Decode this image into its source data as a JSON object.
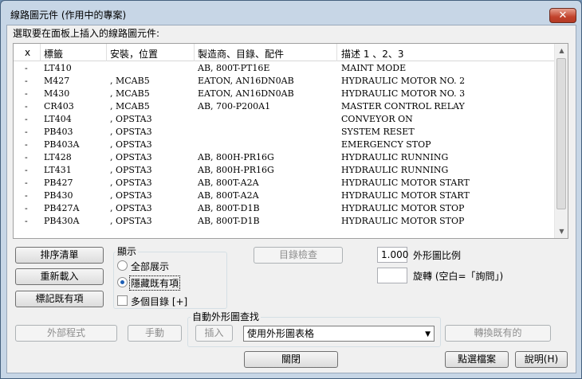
{
  "window": {
    "title": "線路圖元件 (作用中的專案)",
    "close_label": "✕"
  },
  "prompt": "選取要在面板上插入的線路圖元件:",
  "table": {
    "columns": [
      "x",
      "標籤",
      "安裝，位置",
      "製造商、目錄、配件",
      "描述 1 、2、3"
    ],
    "rows": [
      [
        "-",
        "LT410",
        "",
        "AB, 800T-PT16E",
        "MAINT MODE"
      ],
      [
        "-",
        "M427",
        ", MCAB5",
        "EATON, AN16DN0AB",
        "HYDRAULIC MOTOR NO. 2"
      ],
      [
        "-",
        "M430",
        ", MCAB5",
        "EATON, AN16DN0AB",
        "HYDRAULIC MOTOR NO. 3"
      ],
      [
        "-",
        "CR403",
        ", MCAB5",
        "AB, 700-P200A1",
        "MASTER CONTROL RELAY"
      ],
      [
        "-",
        "LT404",
        ", OPSTA3",
        "",
        "CONVEYOR ON"
      ],
      [
        "-",
        "PB403",
        ", OPSTA3",
        "",
        "SYSTEM RESET"
      ],
      [
        "-",
        "PB403A",
        ", OPSTA3",
        "",
        "EMERGENCY STOP"
      ],
      [
        "-",
        "LT428",
        ", OPSTA3",
        "AB, 800H-PR16G",
        "HYDRAULIC RUNNING"
      ],
      [
        "-",
        "LT431",
        ", OPSTA3",
        "AB, 800H-PR16G",
        "HYDRAULIC RUNNING"
      ],
      [
        "-",
        "PB427",
        ", OPSTA3",
        "AB, 800T-A2A",
        "HYDRAULIC MOTOR START"
      ],
      [
        "-",
        "PB430",
        ", OPSTA3",
        "AB, 800T-A2A",
        "HYDRAULIC MOTOR START"
      ],
      [
        "-",
        "PB427A",
        ", OPSTA3",
        "AB, 800T-D1B",
        "HYDRAULIC MOTOR STOP"
      ],
      [
        "-",
        "PB430A",
        ", OPSTA3",
        "AB, 800T-D1B",
        "HYDRAULIC MOTOR STOP"
      ]
    ]
  },
  "left_buttons": {
    "sort": "排序清單",
    "reload": "重新載入",
    "mark": "標記既有項"
  },
  "display": {
    "group_label": "顯示",
    "show_all": "全部展示",
    "hide_existing": "隱藏既有項",
    "multi_catalog": "多個目錄 [+]",
    "selected": "hide_existing",
    "multi_checked": false
  },
  "catalog_check": "目錄檢查",
  "scale": {
    "value": "1.000",
    "label": "外形圖比例"
  },
  "rotate": {
    "value": "",
    "label": "旋轉 (空白=「詢問」)"
  },
  "auto_lookup": {
    "group_label": "自動外形圖查找",
    "insert": "插入",
    "combo_value": "使用外形圖表格"
  },
  "bottom_buttons": {
    "external": "外部程式",
    "manual": "手動",
    "convert": "轉換既有的",
    "close": "關閉",
    "pick_file": "點選檔案",
    "help": "說明(H)"
  }
}
